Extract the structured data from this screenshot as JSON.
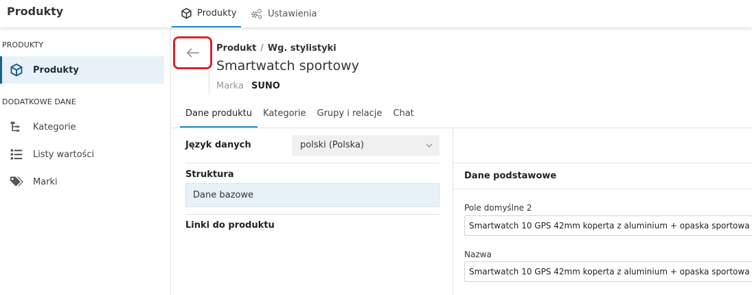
{
  "app": {
    "title": "Produkty"
  },
  "top_tabs": [
    {
      "label": "Produkty",
      "icon": "cube-icon",
      "active": true
    },
    {
      "label": "Ustawienia",
      "icon": "gears-icon",
      "active": false
    }
  ],
  "sidebar": {
    "section1": "PRODUKTY",
    "section2": "DODATKOWE DANE",
    "items": [
      {
        "label": "Produkty",
        "icon": "cube-icon",
        "active": true
      },
      {
        "label": "Kategorie",
        "icon": "tree-icon"
      },
      {
        "label": "Listy wartości",
        "icon": "list-icon"
      },
      {
        "label": "Marki",
        "icon": "tags-icon"
      }
    ]
  },
  "header": {
    "breadcrumb": [
      "Produkt",
      "Wg. stylistyki"
    ],
    "title": "Smartwatch sportowy",
    "brand_label": "Marka",
    "brand_value": "SUNO"
  },
  "content_tabs": [
    "Dane produktu",
    "Kategorie",
    "Grupy i relacje",
    "Chat"
  ],
  "form": {
    "language_label": "Język danych",
    "language_value": "polski (Polska)",
    "structure_label": "Struktura",
    "structure_value": "Dane bazowe",
    "links_label": "Linki do produktu"
  },
  "details": {
    "section_title": "Dane podstawowe",
    "fields": [
      {
        "label": "Pole domyślne 2",
        "value": "Smartwatch 10 GPS 42mm koperta z aluminium + opaska sportowa"
      },
      {
        "label": "Nazwa",
        "value": "Smartwatch 10 GPS 42mm koperta z aluminium + opaska sportowa"
      }
    ]
  },
  "colors": {
    "accent": "#1e88c8",
    "highlight": "#d9242b",
    "active_bg": "#e8f1f7"
  }
}
